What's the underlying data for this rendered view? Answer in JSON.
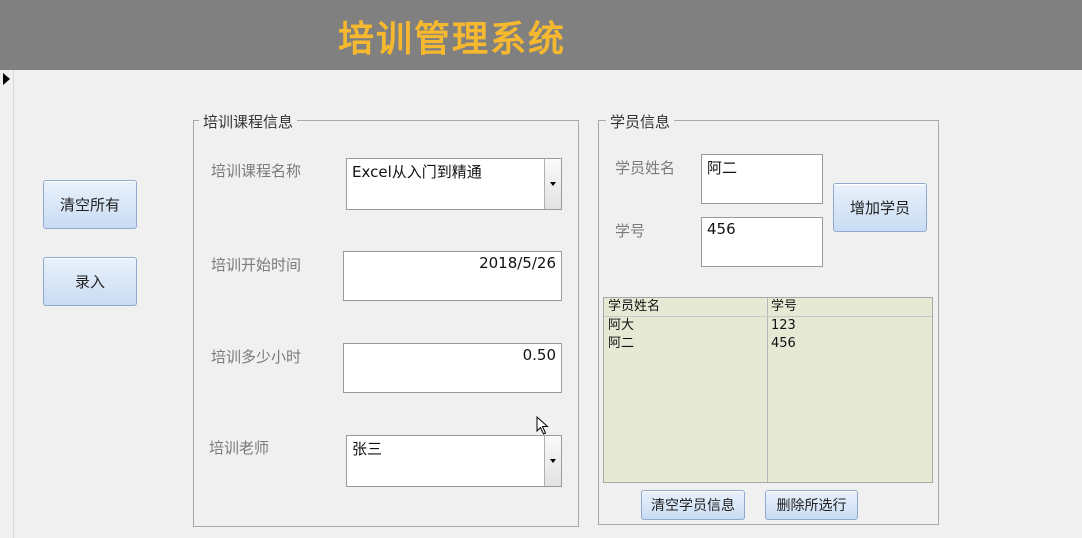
{
  "header": {
    "title": "培训管理系统"
  },
  "actions": {
    "clear_all": "清空所有",
    "enter": "录入"
  },
  "course": {
    "caption": "培训课程信息",
    "name_label": "培训课程名称",
    "name_value": "Excel从入门到精通",
    "start_label": "培训开始时间",
    "start_value": "2018/5/26",
    "hours_label": "培训多少小时",
    "hours_value": "0.50",
    "teacher_label": "培训老师",
    "teacher_value": "张三"
  },
  "student": {
    "caption": "学员信息",
    "name_label": "学员姓名",
    "name_value": "阿二",
    "id_label": "学号",
    "id_value": "456",
    "add_button": "增加学员",
    "list": {
      "columns": [
        "学员姓名",
        "学号"
      ],
      "rows": [
        [
          "阿大",
          "123"
        ],
        [
          "阿二",
          "456"
        ]
      ]
    },
    "clear_button": "清空学员信息",
    "delete_button": "删除所选行"
  },
  "colors": {
    "header_bg": "#808080",
    "title": "#f5b82e",
    "list_bg": "#e6ead5"
  },
  "icons": {
    "record_selector": "triangle-right-icon",
    "pointer": "mouse-cursor-icon"
  }
}
